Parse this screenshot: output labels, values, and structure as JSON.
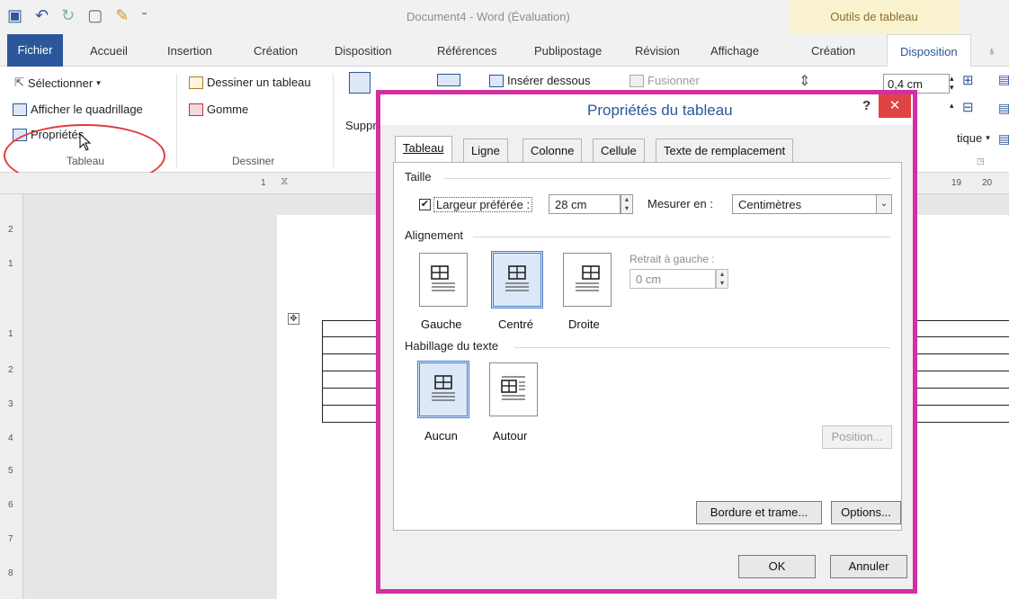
{
  "window": {
    "title": "Document4 - Word (Évaluation)",
    "context_tab": "Outils de tableau",
    "qat_icons": [
      "save-icon",
      "undo-icon",
      "redo-icon",
      "new-doc-icon",
      "brush-icon",
      "customize-icon"
    ]
  },
  "ribbon_tabs": [
    {
      "label": "Fichier"
    },
    {
      "label": "Accueil"
    },
    {
      "label": "Insertion"
    },
    {
      "label": "Création"
    },
    {
      "label": "Disposition"
    },
    {
      "label": "Références"
    },
    {
      "label": "Publipostage"
    },
    {
      "label": "Révision"
    },
    {
      "label": "Affichage"
    },
    {
      "label": "Création"
    },
    {
      "label": "Disposition"
    }
  ],
  "ribbon": {
    "tableau_group": {
      "select": "Sélectionner",
      "gridlines": "Afficher le quadrillage",
      "properties": "Propriétés",
      "title": "Tableau"
    },
    "dessiner_group": {
      "draw_table": "Dessiner un tableau",
      "eraser": "Gomme",
      "title": "Dessiner"
    },
    "delete_partial": "Suppr",
    "insert_below": "Insérer dessous",
    "merge": "Fusionner",
    "height_value": "0,4 cm",
    "align_partial": "tique"
  },
  "ruler": {
    "top_left": "1",
    "top_right": "19",
    "top_far": "20",
    "left_marks": [
      "2",
      "1",
      "1",
      "2",
      "3",
      "4",
      "5",
      "6",
      "7",
      "8"
    ]
  },
  "dialog": {
    "title": "Propriétés du tableau",
    "help": "?",
    "close": "✕",
    "tabs": [
      {
        "label": "Tableau"
      },
      {
        "label": "Ligne"
      },
      {
        "label": "Colonne"
      },
      {
        "label": "Cellule"
      },
      {
        "label": "Texte de remplacement"
      }
    ],
    "taille": {
      "title": "Taille",
      "preferred_width_label": "Largeur préférée :",
      "preferred_width_checked": true,
      "preferred_width_value": "28 cm",
      "measure_label": "Mesurer en :",
      "measure_value": "Centimètres"
    },
    "alignement": {
      "title": "Alignement",
      "options": [
        {
          "label": "Gauche",
          "selected": false
        },
        {
          "label": "Centré",
          "selected": true
        },
        {
          "label": "Droite",
          "selected": false
        }
      ],
      "indent_label": "Retrait à gauche :",
      "indent_value": "0 cm"
    },
    "habillage": {
      "title": "Habillage du texte",
      "options": [
        {
          "label": "Aucun",
          "selected": true
        },
        {
          "label": "Autour",
          "selected": false
        }
      ],
      "position_button": "Position..."
    },
    "buttons": {
      "borders": "Bordure et trame...",
      "options": "Options...",
      "ok": "OK",
      "cancel": "Annuler"
    }
  }
}
